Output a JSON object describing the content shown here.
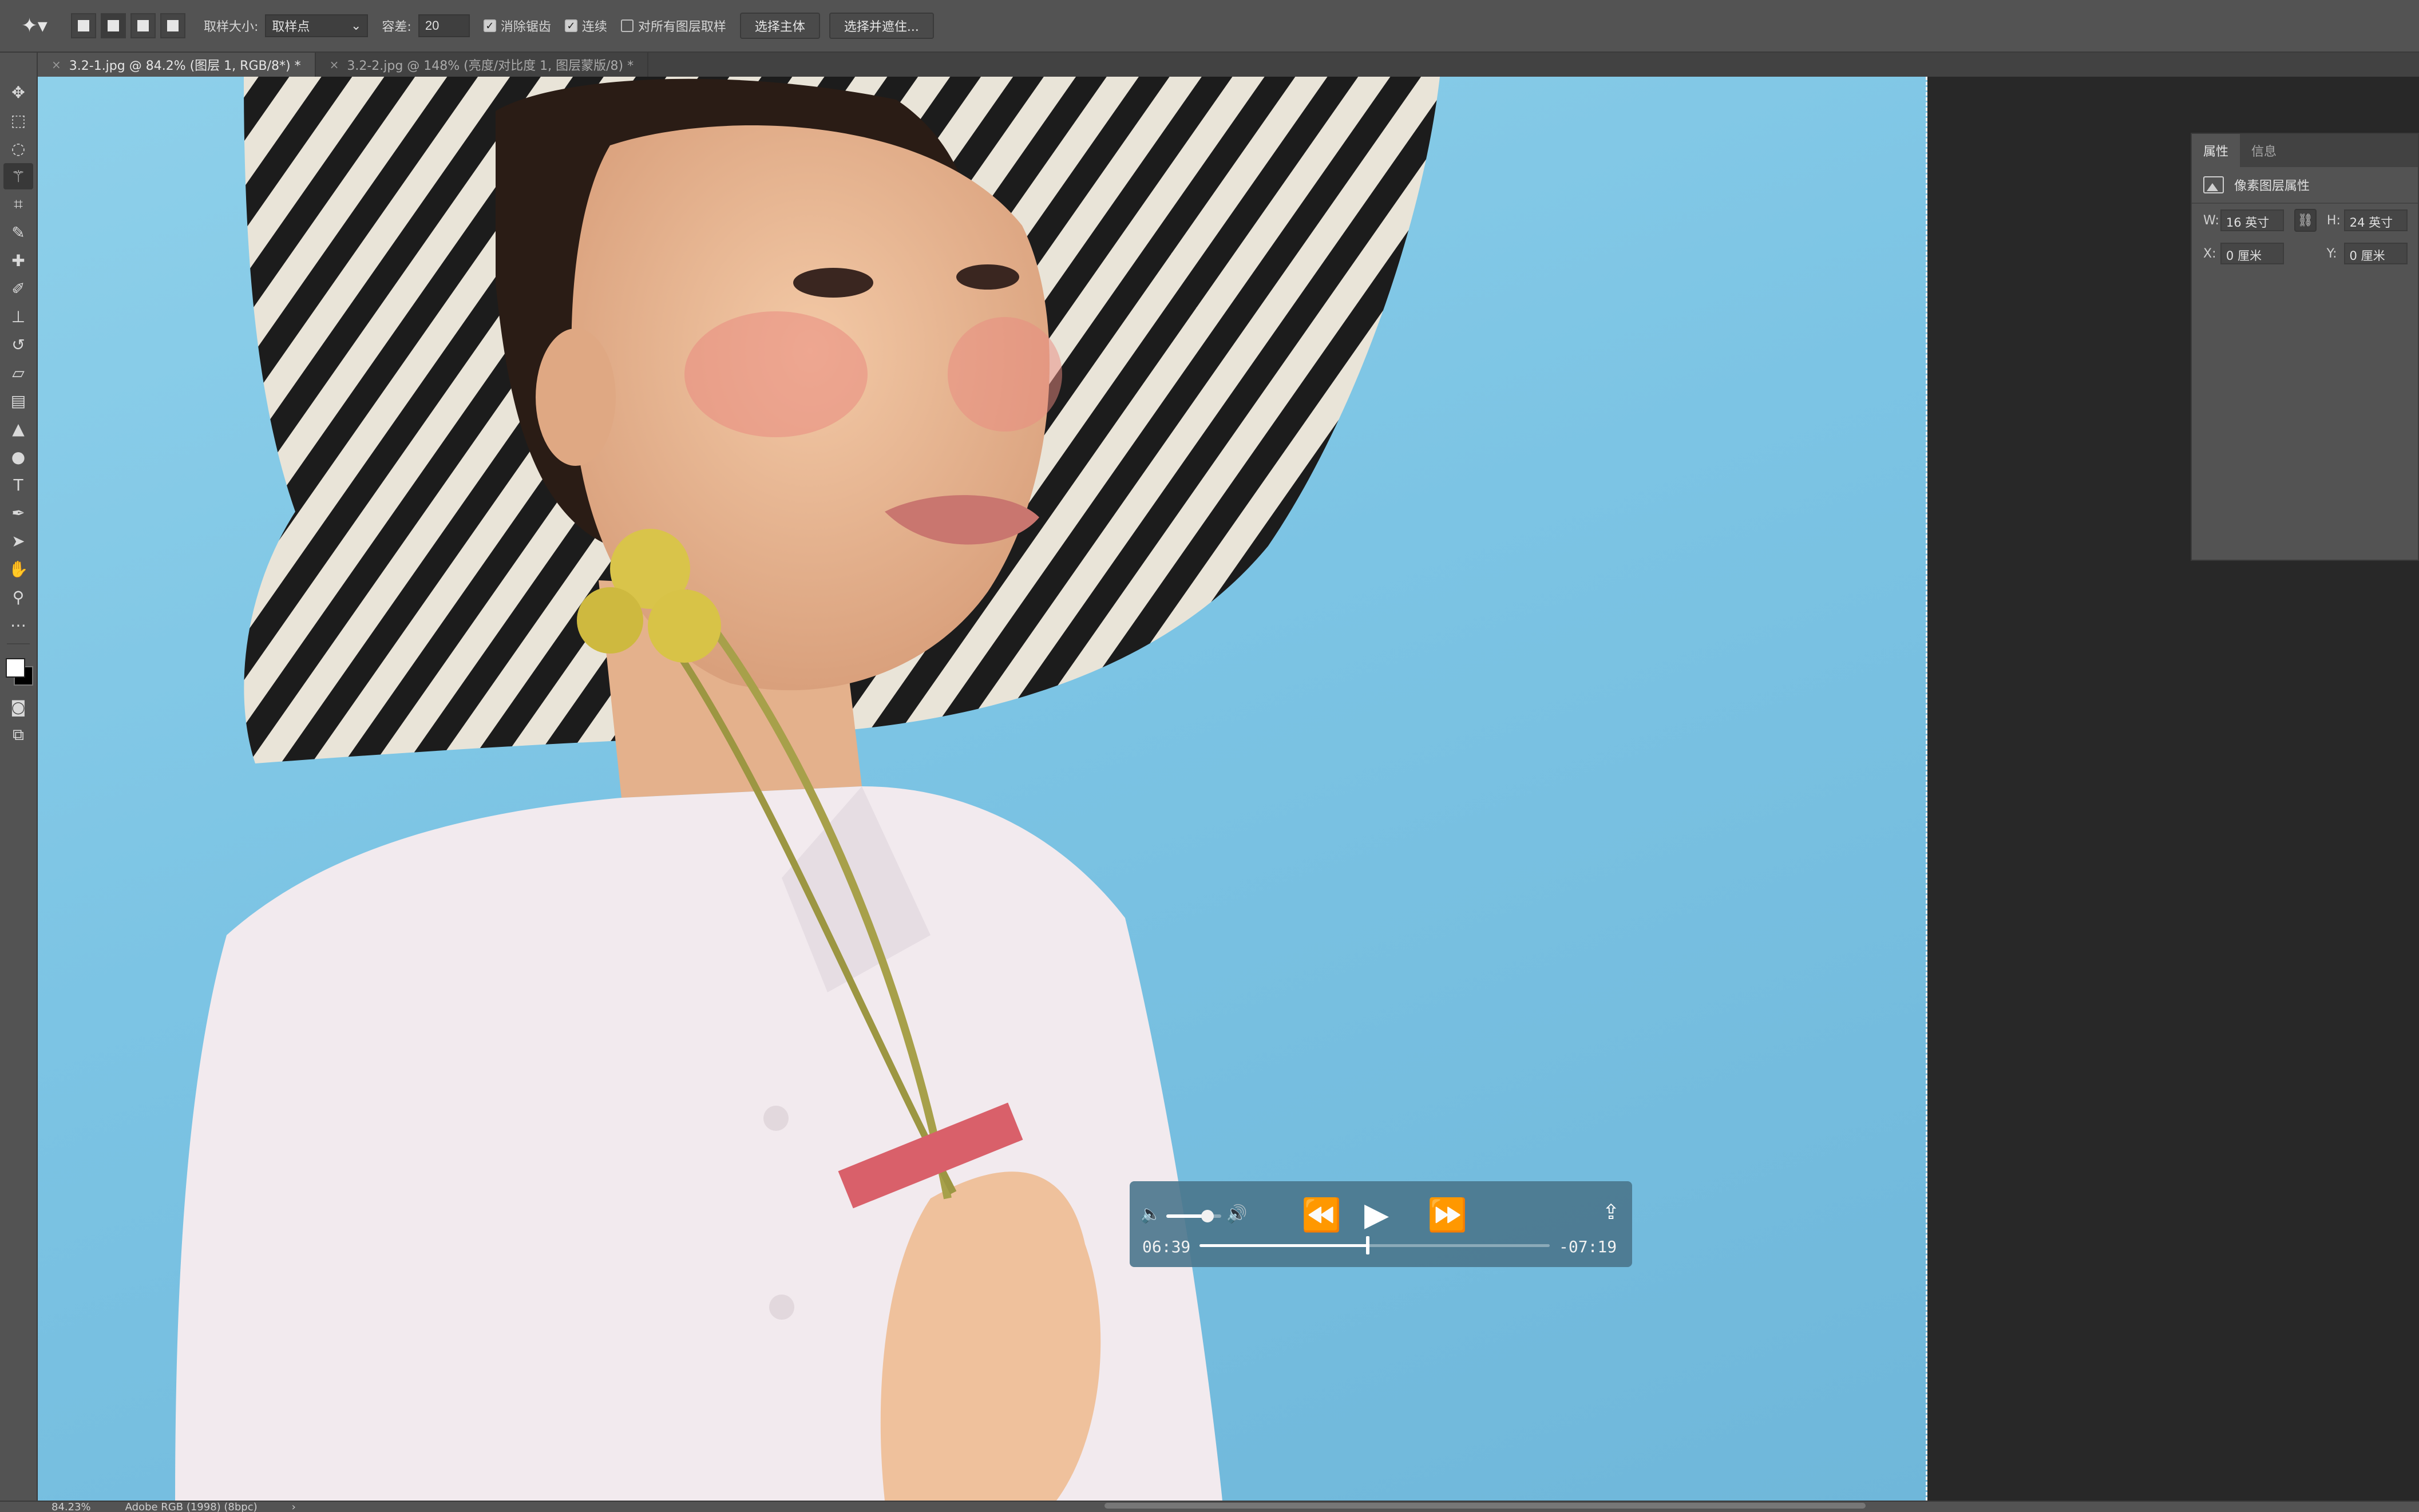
{
  "options_bar": {
    "sample_size_label": "取样大小:",
    "sample_size_value": "取样点",
    "tolerance_label": "容差:",
    "tolerance_value": "20",
    "anti_alias_label": "消除锯齿",
    "anti_alias_checked": true,
    "contiguous_label": "连续",
    "contiguous_checked": true,
    "sample_all_layers_label": "对所有图层取样",
    "sample_all_layers_checked": false,
    "select_subject_label": "选择主体",
    "select_and_mask_label": "选择并遮住..."
  },
  "tabs": [
    {
      "close": "×",
      "label": "3.2-1.jpg @ 84.2% (图层 1, RGB/8*) *",
      "active": true
    },
    {
      "close": "×",
      "label": "3.2-2.jpg @ 148% (亮度/对比度 1, 图层蒙版/8) *",
      "active": false
    }
  ],
  "properties_panel": {
    "tabs": [
      "属性",
      "信息"
    ],
    "section_title": "像素图层属性",
    "w_label": "W:",
    "w_value": "16 英寸",
    "h_label": "H:",
    "h_value": "24 英寸",
    "x_label": "X:",
    "x_value": "0 厘米",
    "y_label": "Y:",
    "y_value": "0 厘米"
  },
  "video_player": {
    "elapsed": "06:39",
    "remaining": "-07:19",
    "progress_fraction": 0.48,
    "volume_fraction": 0.75
  },
  "status_bar": {
    "zoom": "84.23%",
    "color_profile": "Adobe RGB (1998) (8bpc)",
    "arrow": "›"
  },
  "colors": {
    "foreground": "#ffffff",
    "background": "#000000",
    "ui_panel": "#535353",
    "canvas_backdrop": "#282828",
    "photo_sky": "#86cbe7"
  },
  "icons": {
    "toolbar": [
      "move-icon",
      "marquee-icon",
      "lasso-icon",
      "magic-wand-icon",
      "crop-icon",
      "eyedropper-icon",
      "healing-brush-icon",
      "brush-icon",
      "stamp-icon",
      "history-brush-icon",
      "eraser-icon",
      "gradient-icon",
      "blur-icon",
      "dodge-icon",
      "pen-icon",
      "type-icon",
      "path-selection-icon",
      "shape-icon",
      "hand-icon",
      "zoom-icon",
      "more-icon"
    ]
  }
}
